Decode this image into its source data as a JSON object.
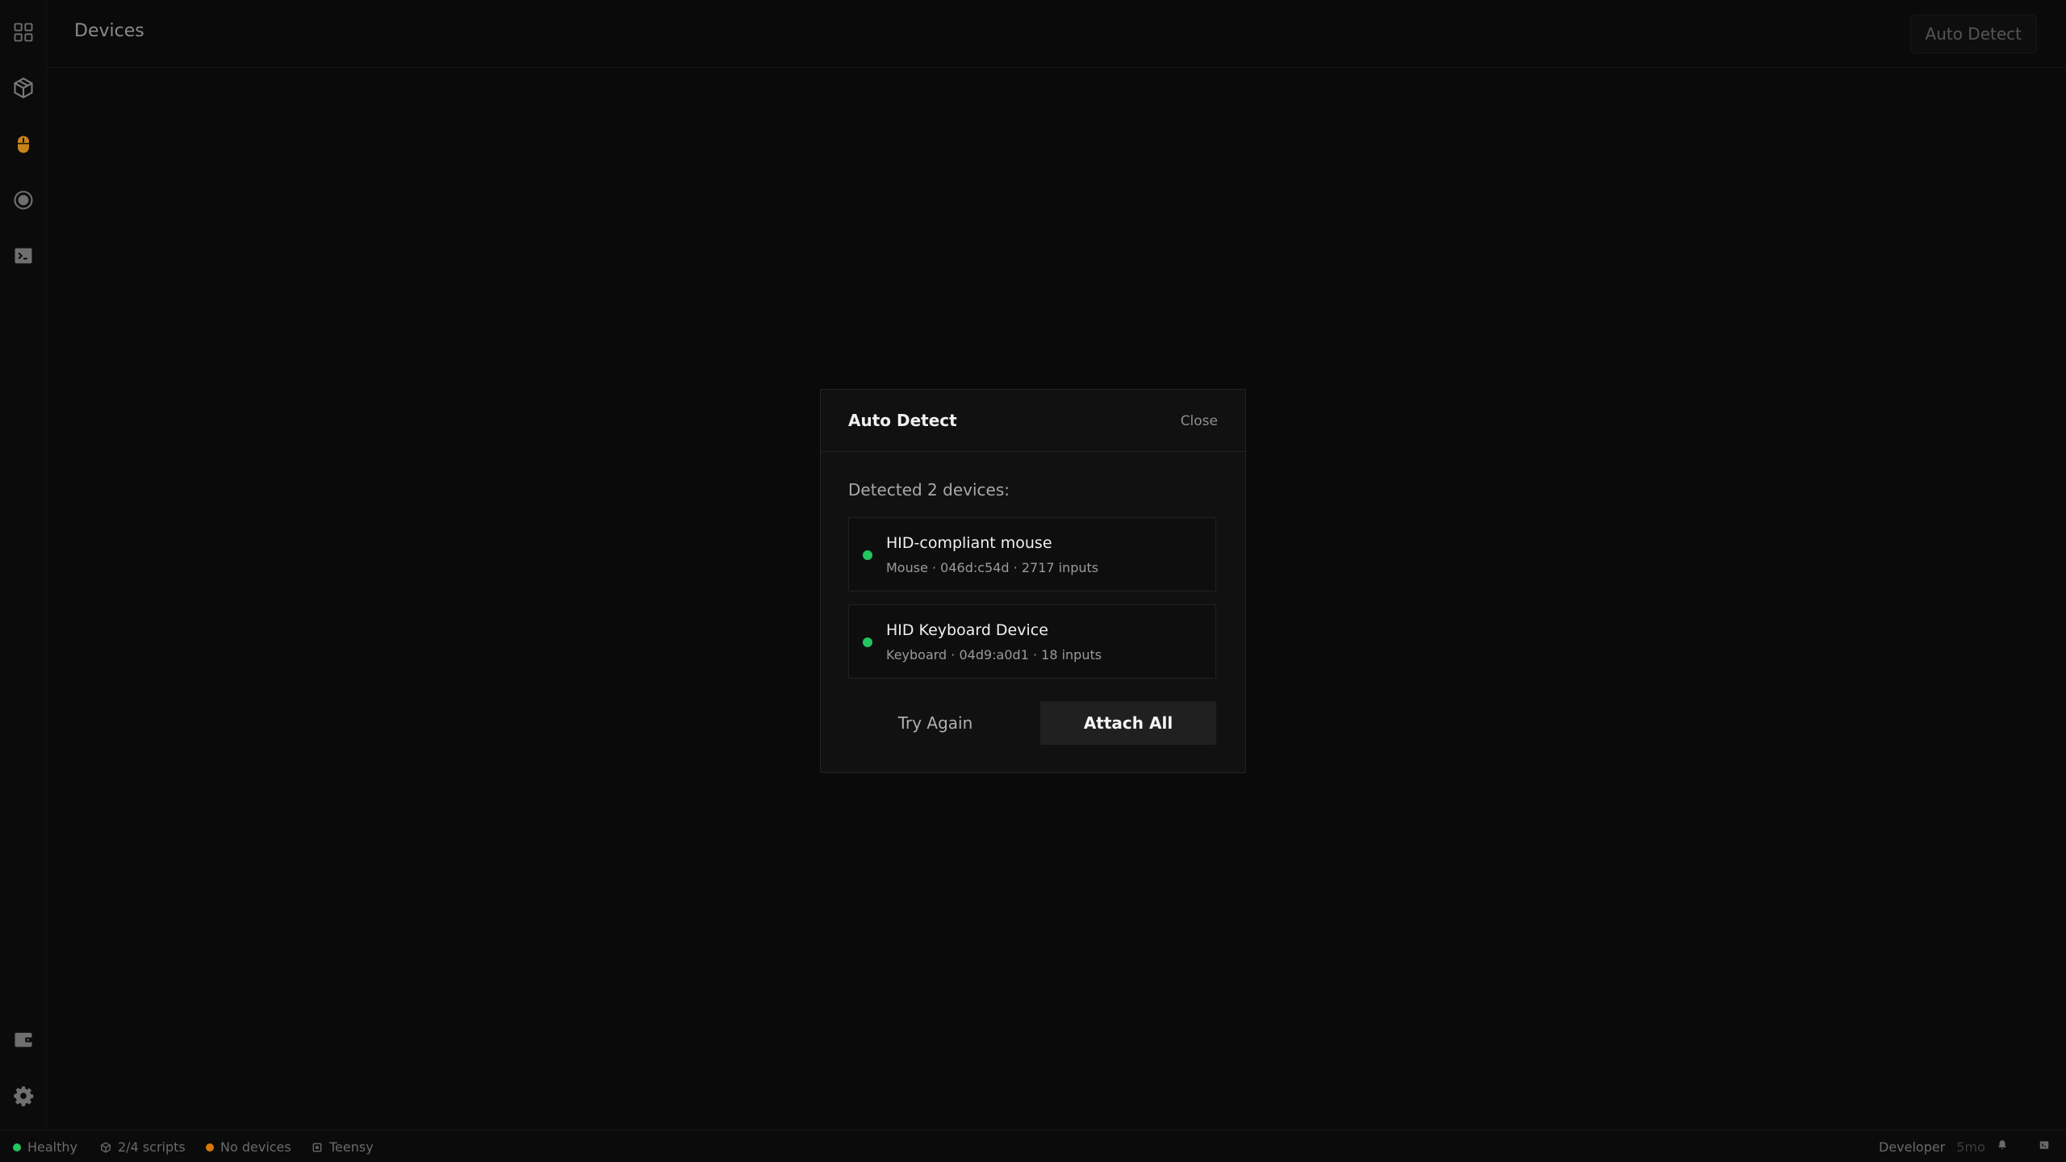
{
  "header": {
    "title": "Devices",
    "auto_detect_label": "Auto Detect"
  },
  "sidebar": {
    "items": [
      {
        "icon": "grid-icon"
      },
      {
        "icon": "package-icon"
      },
      {
        "icon": "mouse-icon",
        "active": true
      },
      {
        "icon": "record-icon"
      },
      {
        "icon": "terminal-icon"
      }
    ],
    "bottom_items": [
      {
        "icon": "wallet-icon"
      },
      {
        "icon": "gear-icon"
      }
    ]
  },
  "modal": {
    "title": "Auto Detect",
    "close_label": "Close",
    "detected_text": "Detected 2 devices:",
    "devices": [
      {
        "name": "HID-compliant mouse",
        "meta": "Mouse · 046d:c54d · 2717 inputs",
        "status_color": "#22c55e"
      },
      {
        "name": "HID Keyboard Device",
        "meta": "Keyboard · 04d9:a0d1 · 18 inputs",
        "status_color": "#22c55e"
      }
    ],
    "try_again_label": "Try Again",
    "attach_all_label": "Attach All"
  },
  "statusbar": {
    "health_label": "Healthy",
    "health_color": "#22c55e",
    "scripts_label": "2/4 scripts",
    "devices_label": "No devices",
    "devices_color": "#d97706",
    "board_label": "Teensy",
    "mode_label": "Developer",
    "mode_time": "5mo"
  },
  "colors": {
    "accent_orange": "#c8831a",
    "background": "#0a0a0a"
  }
}
